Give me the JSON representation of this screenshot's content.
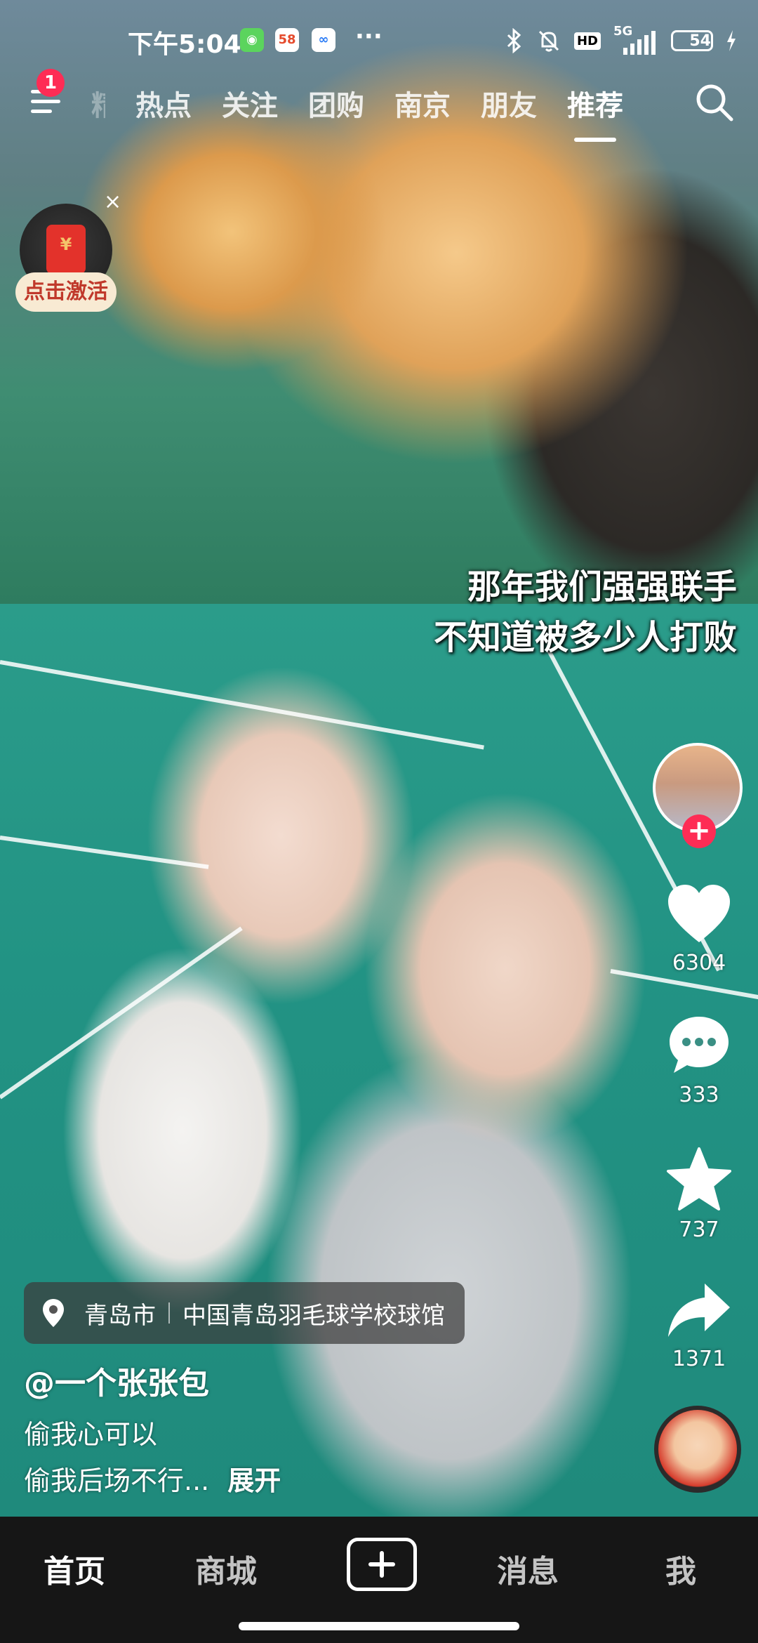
{
  "status_bar": {
    "time": "下午5:04",
    "app_icons": [
      "wechat-icon",
      "58-app-icon",
      "baidu-netdisk-icon"
    ],
    "more": "···",
    "hd": "HD",
    "network": "5G",
    "battery": "54",
    "battery_level": 0.54
  },
  "top_nav": {
    "notification_count": "1",
    "tabs": [
      "精",
      "热点",
      "关注",
      "团购",
      "南京",
      "朋友",
      "推荐"
    ],
    "active_tab": "推荐"
  },
  "red_packet": {
    "label": "点击激活",
    "close": "×"
  },
  "captions": {
    "line1": "那年我们强强联手",
    "line2": "不知道被多少人打败"
  },
  "actions": {
    "follow": "+",
    "likes": "6304",
    "comments": "333",
    "favorites": "737",
    "shares": "1371"
  },
  "post": {
    "location_city": "青岛市",
    "location_place": "中国青岛羽毛球学校球馆",
    "author": "@一个张张包",
    "desc_line1": "偷我心可以",
    "desc_line2": "偷我后场不行...",
    "expand": "展开"
  },
  "bottom_nav": {
    "home": "首页",
    "mall": "商城",
    "messages": "消息",
    "me": "我"
  },
  "colors": {
    "accent": "#fe2c55",
    "nav_bg": "#161616",
    "battery_fill": "#45d36b"
  }
}
